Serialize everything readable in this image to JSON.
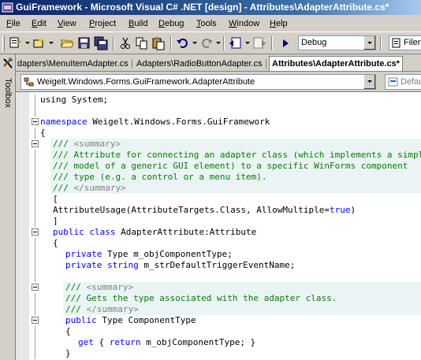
{
  "window": {
    "title": "GuiFramework - Microsoft Visual C# .NET [design] - Attributes\\AdapterAttribute.cs*"
  },
  "menu": {
    "items": [
      {
        "label": "File",
        "underline": "F",
        "rest": "ile"
      },
      {
        "label": "Edit",
        "underline": "E",
        "rest": "dit"
      },
      {
        "label": "View",
        "underline": "V",
        "rest": "iew"
      },
      {
        "label": "Project",
        "underline": "P",
        "rest": "roject"
      },
      {
        "label": "Build",
        "underline": "B",
        "rest": "uild"
      },
      {
        "label": "Debug",
        "underline": "D",
        "rest": "ebug"
      },
      {
        "label": "Tools",
        "underline": "T",
        "rest": "ools"
      },
      {
        "label": "Window",
        "underline": "W",
        "rest": "indow"
      },
      {
        "label": "Help",
        "underline": "H",
        "rest": "elp"
      }
    ]
  },
  "toolbar": {
    "configuration": "Debug",
    "find_combo": "Filen",
    "icons": [
      "new-project-icon",
      "add-item-icon",
      "open-icon",
      "save-icon",
      "save-all-icon",
      "cut-icon",
      "copy-icon",
      "paste-icon",
      "undo-icon",
      "redo-icon",
      "navigate-back-icon",
      "navigate-forward-icon",
      "start-icon"
    ]
  },
  "sidebar": {
    "toolbox_label": "Toolbox"
  },
  "tabs": [
    {
      "label": "dapters\\MenuItemAdapter.cs",
      "active": false
    },
    {
      "label": "Adapters\\RadioButtonAdapter.cs",
      "active": false
    },
    {
      "label": "Attributes\\AdapterAttribute.cs*",
      "active": true
    }
  ],
  "navbar": {
    "type_combo": "Weigelt.Windows.Forms.GuiFramework.AdapterAttribute",
    "member_combo": "DefaultTr"
  },
  "code": {
    "lines": [
      {
        "indent": 0,
        "parts": [
          [
            "",
            "using System;"
          ]
        ]
      },
      {
        "indent": 0,
        "parts": []
      },
      {
        "indent": 0,
        "fold": true,
        "parts": [
          [
            "kw",
            "namespace"
          ],
          [
            "",
            " Weigelt.Windows.Forms.GuiFramework"
          ]
        ]
      },
      {
        "indent": 0,
        "parts": [
          [
            "",
            "{"
          ]
        ]
      },
      {
        "indent": 1,
        "fold": true,
        "hl": true,
        "parts": [
          [
            "cm",
            "/// "
          ],
          [
            "cmg",
            "<summary>"
          ]
        ]
      },
      {
        "indent": 1,
        "hl": true,
        "parts": [
          [
            "cm",
            "/// Attribute for connecting an adapter class (which implements a simple"
          ]
        ]
      },
      {
        "indent": 1,
        "hl": true,
        "parts": [
          [
            "cm",
            "/// model of a generic GUI element) to a specific WinForms component"
          ]
        ]
      },
      {
        "indent": 1,
        "hl": true,
        "parts": [
          [
            "cm",
            "/// type (e.g. a control or a menu item)."
          ]
        ]
      },
      {
        "indent": 1,
        "hl": true,
        "parts": [
          [
            "cm",
            "/// "
          ],
          [
            "cmg",
            "</summary>"
          ]
        ]
      },
      {
        "indent": 1,
        "parts": [
          [
            "",
            "["
          ]
        ]
      },
      {
        "indent": 1,
        "parts": [
          [
            "",
            "AttributeUsage(AttributeTargets.Class, AllowMultiple="
          ],
          [
            "kw",
            "true"
          ],
          [
            "",
            ")"
          ]
        ]
      },
      {
        "indent": 1,
        "parts": [
          [
            "",
            "]"
          ]
        ]
      },
      {
        "indent": 1,
        "fold": true,
        "parts": [
          [
            "kw",
            "public class"
          ],
          [
            "",
            " AdapterAttribute:Attribute"
          ]
        ]
      },
      {
        "indent": 1,
        "parts": [
          [
            "",
            "{"
          ]
        ]
      },
      {
        "indent": 2,
        "parts": [
          [
            "kw",
            "private"
          ],
          [
            "",
            " Type m_objComponentType;"
          ]
        ]
      },
      {
        "indent": 2,
        "parts": [
          [
            "kw",
            "private string"
          ],
          [
            "",
            " m_strDefaultTriggerEventName;"
          ]
        ]
      },
      {
        "indent": 2,
        "parts": []
      },
      {
        "indent": 2,
        "fold": true,
        "hl": true,
        "parts": [
          [
            "cm",
            "/// "
          ],
          [
            "cmg",
            "<summary>"
          ]
        ]
      },
      {
        "indent": 2,
        "hl": true,
        "parts": [
          [
            "cm",
            "/// Gets the type associated with the adapter class."
          ]
        ]
      },
      {
        "indent": 2,
        "hl": true,
        "parts": [
          [
            "cm",
            "/// "
          ],
          [
            "cmg",
            "</summary>"
          ]
        ]
      },
      {
        "indent": 2,
        "fold": true,
        "parts": [
          [
            "kw",
            "public"
          ],
          [
            "",
            " Type ComponentType"
          ]
        ]
      },
      {
        "indent": 2,
        "parts": [
          [
            "",
            "{"
          ]
        ]
      },
      {
        "indent": 3,
        "parts": [
          [
            "kw",
            "get"
          ],
          [
            "",
            " { "
          ],
          [
            "kw",
            "return"
          ],
          [
            "",
            " m_objComponentType; }"
          ]
        ]
      },
      {
        "indent": 2,
        "parts": [
          [
            "",
            "}"
          ]
        ]
      }
    ]
  }
}
